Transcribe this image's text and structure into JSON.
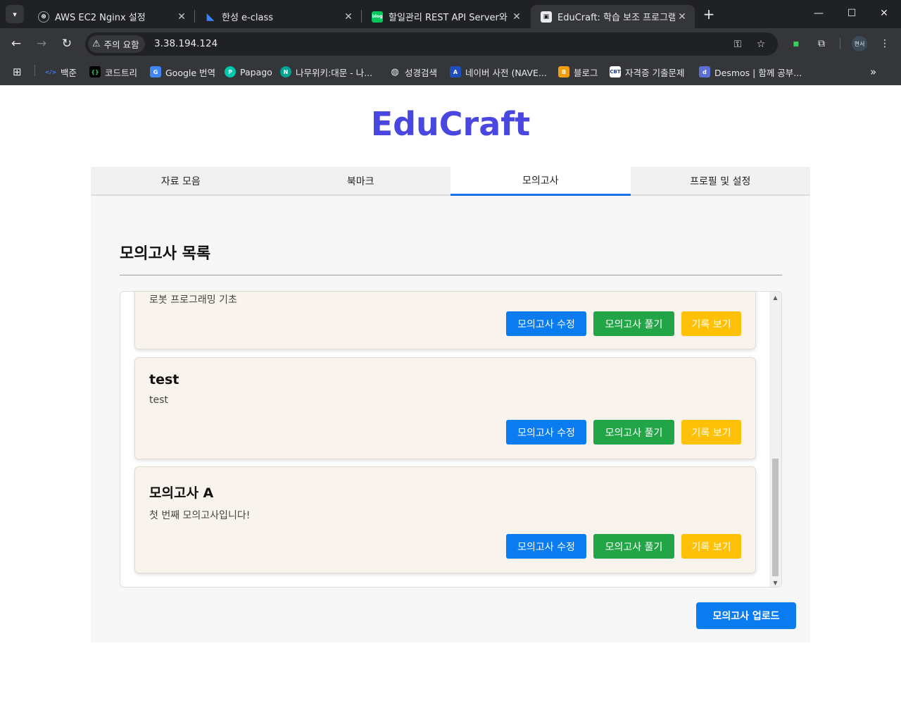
{
  "browser": {
    "tabs": [
      {
        "title": "AWS EC2 Nginx 설정"
      },
      {
        "title": "한성 e-class"
      },
      {
        "title": "할일관리 REST API Server와 Cl"
      },
      {
        "title": "EduCraft: 학습 보조 프로그램"
      }
    ],
    "security_label": "주의 요함",
    "url": "3.38.194.124",
    "profile_label": "현서",
    "bookmarks": [
      {
        "label": "백준"
      },
      {
        "label": "코드트리"
      },
      {
        "label": "Google 번역"
      },
      {
        "label": "Papago"
      },
      {
        "label": "나무위키:대문 - 나..."
      },
      {
        "label": "성경검색"
      },
      {
        "label": "네이버 사전 (NAVE..."
      },
      {
        "label": "블로그"
      },
      {
        "label": "자격증 기출문제"
      },
      {
        "label": "Desmos | 함께 공부..."
      }
    ],
    "icons": {
      "tab_list": "chevron-down-icon",
      "new_tab": "plus-icon",
      "minimize": "minimize-icon",
      "maximize": "maximize-icon",
      "close": "close-icon",
      "back": "arrow-left-icon",
      "forward": "arrow-right-icon",
      "reload": "reload-icon",
      "warning": "warning-icon",
      "password": "key-icon",
      "star": "star-icon",
      "extension": "puzzle-icon",
      "menu": "kebab-menu-icon",
      "apps": "apps-grid-icon",
      "overflow": "chevron-double-right-icon"
    }
  },
  "app": {
    "brand": "EduCraft",
    "brand_color": "#4a46e0",
    "nav_tabs": [
      {
        "label": "자료 모음",
        "active": false
      },
      {
        "label": "북마크",
        "active": false
      },
      {
        "label": "모의고사",
        "active": true
      },
      {
        "label": "프로필 및 설정",
        "active": false
      }
    ],
    "section_title": "모의고사 목록",
    "exams": [
      {
        "title": "",
        "description": "로봇 프로그래밍 기초",
        "partially_hidden": true
      },
      {
        "title": "test",
        "description": "test"
      },
      {
        "title": "모의고사 A",
        "description": "첫 번째 모의고사입니다!"
      }
    ],
    "card_buttons": {
      "edit": "모의고사 수정",
      "solve": "모의고사 풀기",
      "history": "기록 보기"
    },
    "upload_button": "모의고사 업로드",
    "colors": {
      "primary": "#0a7cf0",
      "success": "#22a546",
      "warning": "#ffc107",
      "active_tab_border": "#1a73e8"
    }
  }
}
